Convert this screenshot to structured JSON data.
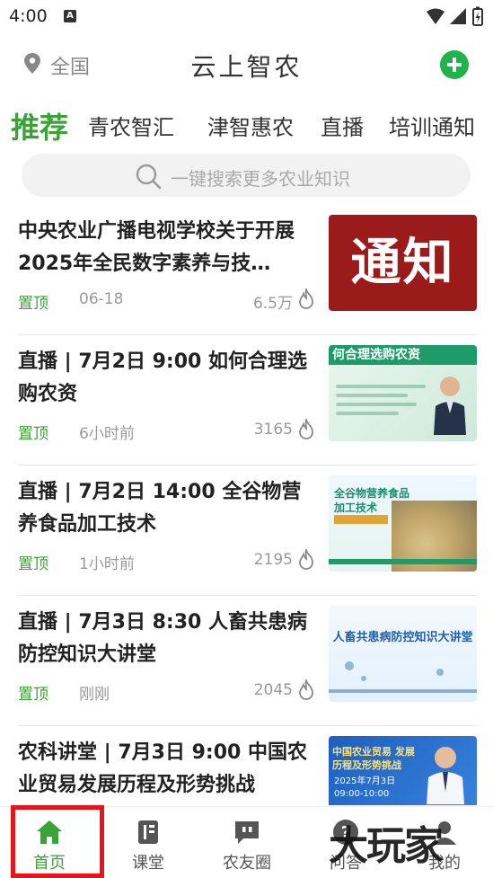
{
  "status_bar": {
    "time": "4:00",
    "notification": "A"
  },
  "header": {
    "location": "全国",
    "title": "云上智农"
  },
  "tabs": [
    {
      "label": "推荐",
      "active": true
    },
    {
      "label": "青农智汇"
    },
    {
      "label": "津智惠农"
    },
    {
      "label": "直播"
    },
    {
      "label": "培训通知"
    }
  ],
  "search": {
    "placeholder": "一键搜索更多农业知识"
  },
  "feed": [
    {
      "title": "中央农业广播电视学校关于开展2025年全民数字素养与技…",
      "pin": "置顶",
      "time": "06-18",
      "views": "6.5万",
      "thumb_text": "通知"
    },
    {
      "title": "直播 | 7月2日 9:00 如何合理选购农资",
      "pin": "置顶",
      "time": "6小时前",
      "views": "3165",
      "thumb_text": "何合理选购农资"
    },
    {
      "title": "直播 | 7月2日 14:00 全谷物营养食品加工技术",
      "pin": "置顶",
      "time": "1小时前",
      "views": "2195",
      "thumb_text": "全谷物营养食品 加工技术"
    },
    {
      "title": "直播 | 7月3日 8:30 人畜共患病防控知识大讲堂",
      "pin": "置顶",
      "time": "刚刚",
      "views": "2045",
      "thumb_text": "人畜共患病防控知识大讲堂"
    },
    {
      "title": "农科讲堂 | 7月3日 9:00 中国农业贸易发展历程及形势挑战",
      "pin": "",
      "time": "",
      "views": "",
      "thumb_text": "中国农业贸易 发展历程及形势挑战",
      "thumb_sub": "2025年7月3日 09:00-10:00"
    }
  ],
  "bottom_nav": [
    {
      "label": "首页",
      "icon": "home-icon",
      "active": true
    },
    {
      "label": "课堂",
      "icon": "book-icon"
    },
    {
      "label": "农友圈",
      "icon": "chat-quote-icon"
    },
    {
      "label": "问答",
      "icon": "question-icon"
    },
    {
      "label": "我的",
      "icon": "profile-icon"
    }
  ],
  "watermark": "大玩家",
  "colors": {
    "accent": "#3aa335",
    "add_button": "#22b24c",
    "highlight": "#e8141c"
  }
}
